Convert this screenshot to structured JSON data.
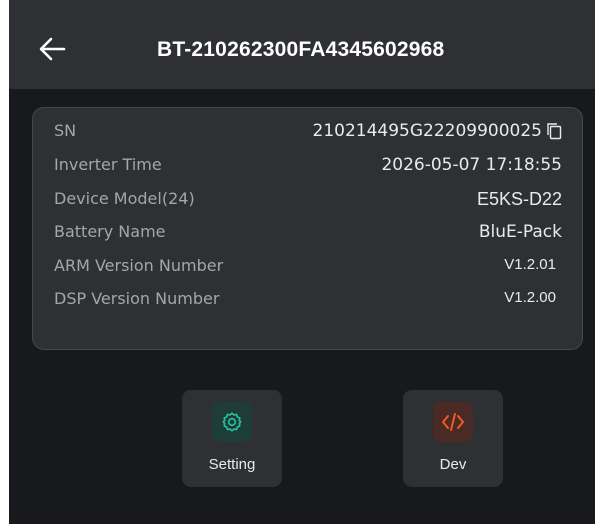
{
  "header": {
    "title": "BT-210262300FA4345602968",
    "back_icon": "arrow-left-icon"
  },
  "device_info": {
    "rows": [
      {
        "label": "SN",
        "value": "210214495G22209900025"
      },
      {
        "label": "Inverter Time",
        "value": "2026-05-07 17:18:55"
      },
      {
        "label": "Device Model(24)",
        "value": "E5KS-D22"
      },
      {
        "label": "Battery Name",
        "value": "BluE-Pack"
      },
      {
        "label": "ARM Version Number",
        "value": "V1.2.01"
      },
      {
        "label": "DSP Version Number",
        "value": "V1.2.00"
      }
    ],
    "copy_icon": "copy-icon"
  },
  "actions": [
    {
      "label": "Setting",
      "icon": "gear-icon",
      "icon_color": "#26c29a",
      "icon_bg": "#1f3d38"
    },
    {
      "label": "Dev",
      "icon": "code-icon",
      "icon_color": "#f05a28",
      "icon_bg": "#4a2a24"
    }
  ],
  "colors": {
    "background": "#17191d",
    "header": "#2f3034",
    "card": "#2e3033",
    "label": "#a4a6aa",
    "value": "#e9eaec"
  }
}
